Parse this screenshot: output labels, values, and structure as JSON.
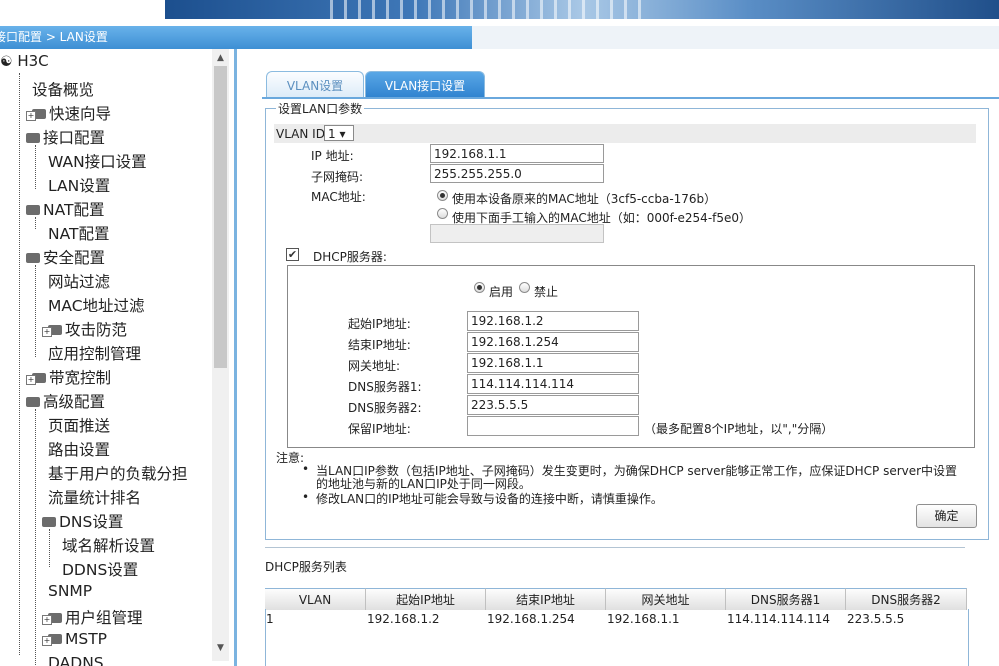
{
  "breadcrumb": "接口配置 > LAN设置",
  "tree": {
    "root": "H3C",
    "items": [
      {
        "label": "设备概览"
      },
      {
        "label": "快速向导"
      },
      {
        "label": "接口配置"
      },
      {
        "label": "WAN接口设置"
      },
      {
        "label": "LAN设置"
      },
      {
        "label": "NAT配置"
      },
      {
        "label": "NAT配置"
      },
      {
        "label": "安全配置"
      },
      {
        "label": "网站过滤"
      },
      {
        "label": "MAC地址过滤"
      },
      {
        "label": "攻击防范"
      },
      {
        "label": "应用控制管理"
      },
      {
        "label": "带宽控制"
      },
      {
        "label": "高级配置"
      },
      {
        "label": "页面推送"
      },
      {
        "label": "路由设置"
      },
      {
        "label": "基于用户的负载分担"
      },
      {
        "label": "流量统计排名"
      },
      {
        "label": "DNS设置"
      },
      {
        "label": "域名解析设置"
      },
      {
        "label": "DDNS设置"
      },
      {
        "label": "SNMP"
      },
      {
        "label": "用户组管理"
      },
      {
        "label": "MSTP"
      },
      {
        "label": "DADNS"
      }
    ]
  },
  "tabs": [
    {
      "label": "VLAN设置"
    },
    {
      "label": "VLAN接口设置"
    }
  ],
  "lan": {
    "legend": "设置LAN口参数",
    "vlan_id_label": "VLAN ID",
    "vlan_id_value": "1 ▾",
    "ip_label": "IP 地址:",
    "ip_value": "192.168.1.1",
    "mask_label": "子网掩码:",
    "mask_value": "255.255.255.0",
    "mac_label": "MAC地址:",
    "mac_opt1": "使用本设备原来的MAC地址（3cf5-ccba-176b）",
    "mac_opt2": "使用下面手工输入的MAC地址（如：000f-e254-f5e0）",
    "mac_manual_value": ""
  },
  "dhcp": {
    "checkbox_label": "DHCP服务器:",
    "enable_label": "启用",
    "disable_label": "禁止",
    "start_label": "起始IP地址:",
    "start_value": "192.168.1.2",
    "end_label": "结束IP地址:",
    "end_value": "192.168.1.254",
    "gw_label": "网关地址:",
    "gw_value": "192.168.1.1",
    "dns1_label": "DNS服务器1:",
    "dns1_value": "114.114.114.114",
    "dns2_label": "DNS服务器2:",
    "dns2_value": "223.5.5.5",
    "reserved_label": "保留IP地址:",
    "reserved_value": "",
    "reserved_hint": "（最多配置8个IP地址，以\",\"分隔）"
  },
  "notes": {
    "title": "注意:",
    "n1a": "当LAN口IP参数（包括IP地址、子网掩码）发生变更时，为确保DHCP server能够正常工作，应保证DHCP server中设置",
    "n1b": "的地址池与新的LAN口IP处于同一网段。",
    "n2": "修改LAN口的IP地址可能会导致与设备的连接中断，请慎重操作。"
  },
  "ok_button": "确定",
  "dhcp_list": {
    "title": "DHCP服务列表",
    "columns": [
      "VLAN",
      "起始IP地址",
      "结束IP地址",
      "网关地址",
      "DNS服务器1",
      "DNS服务器2"
    ],
    "rows": [
      [
        "1",
        "192.168.1.2",
        "192.168.1.254",
        "192.168.1.1",
        "114.114.114.114",
        "223.5.5.5"
      ]
    ]
  }
}
